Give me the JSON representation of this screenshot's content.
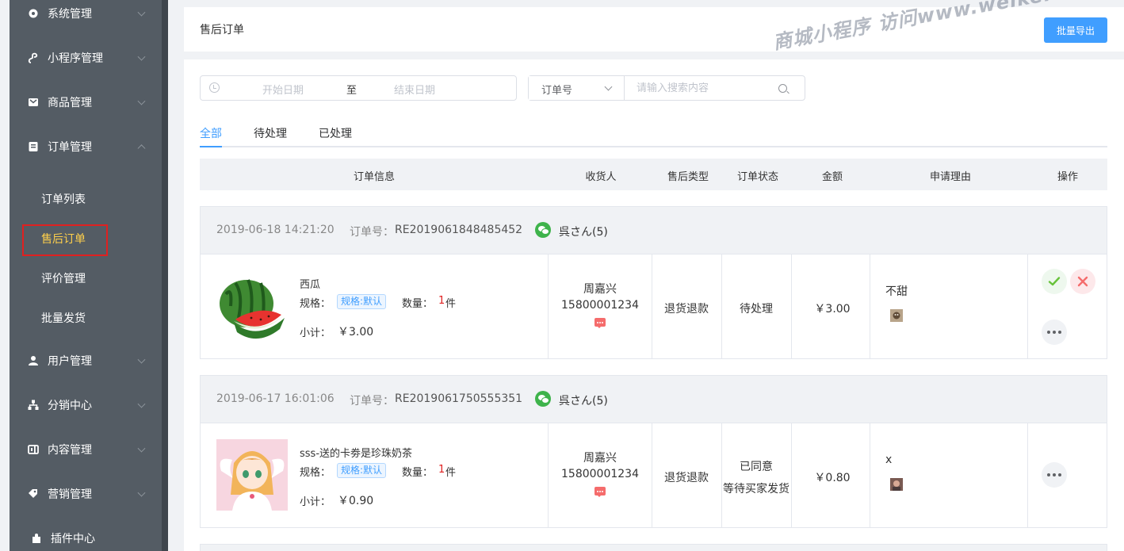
{
  "sidebar": {
    "menu": [
      {
        "label": "系统管理",
        "icon": "gear-icon"
      },
      {
        "label": "小程序管理",
        "icon": "miniprogram-icon"
      },
      {
        "label": "商品管理",
        "icon": "goods-icon"
      },
      {
        "label": "订单管理",
        "icon": "order-icon"
      },
      {
        "label": "用户管理",
        "icon": "user-icon"
      },
      {
        "label": "分销中心",
        "icon": "distribution-icon"
      },
      {
        "label": "内容管理",
        "icon": "content-icon"
      },
      {
        "label": "营销管理",
        "icon": "marketing-icon"
      },
      {
        "label": "插件中心",
        "icon": "plugin-icon"
      }
    ],
    "order_submenu": [
      "订单列表",
      "售后订单",
      "评价管理",
      "批量发货"
    ],
    "active_submenu": "售后订单"
  },
  "header": {
    "title": "售后订单",
    "export_label": "批量导出",
    "watermark": "商城小程序 访问www.weike.fc"
  },
  "filters": {
    "date_start_placeholder": "开始日期",
    "date_separator": "至",
    "date_end_placeholder": "结束日期",
    "search_field": "订单号",
    "search_placeholder": "请输入搜索内容"
  },
  "tabs": [
    "全部",
    "待处理",
    "已处理"
  ],
  "active_tab": "全部",
  "table_headers": [
    "订单信息",
    "收货人",
    "售后类型",
    "订单状态",
    "金额",
    "申请理由",
    "操作"
  ],
  "orders": [
    {
      "time": "2019-06-18 14:21:20",
      "order_no_label": "订单号：",
      "order_no": "RE2019061848485452",
      "user": "呉さん(5)",
      "product_name": "西瓜",
      "spec_label": "规格：",
      "spec_value": "规格:默认",
      "qty_label": "数量：",
      "qty": "1",
      "qty_unit": "件",
      "subtotal_label": "小计：",
      "subtotal": "￥3.00",
      "receiver": "周嘉兴",
      "phone": "15800001234",
      "aftersale_type": "退货退款",
      "status_line1": "待处理",
      "status_line2": "",
      "amount": "￥3.00",
      "reason": "不甜",
      "actions": [
        "approve",
        "reject",
        "more"
      ]
    },
    {
      "time": "2019-06-17 16:01:06",
      "order_no_label": "订单号：",
      "order_no": "RE2019061750555351",
      "user": "呉さん(5)",
      "product_name": "sss-送的卡劵是珍珠奶茶",
      "spec_label": "规格：",
      "spec_value": "规格:默认",
      "qty_label": "数量：",
      "qty": "1",
      "qty_unit": "件",
      "subtotal_label": "小计：",
      "subtotal": "￥0.90",
      "receiver": "周嘉兴",
      "phone": "15800001234",
      "aftersale_type": "退货退款",
      "status_line1": "已同意",
      "status_line2": "等待买家发货",
      "amount": "￥0.80",
      "reason": "x",
      "actions": [
        "more"
      ]
    }
  ],
  "colors": {
    "sidebar_bg": "#545c64",
    "active_menu": "#ffd04b",
    "primary": "#409eff",
    "approve": "#67c23a",
    "reject": "#f56c6c",
    "wechat": "#3eb34b"
  }
}
